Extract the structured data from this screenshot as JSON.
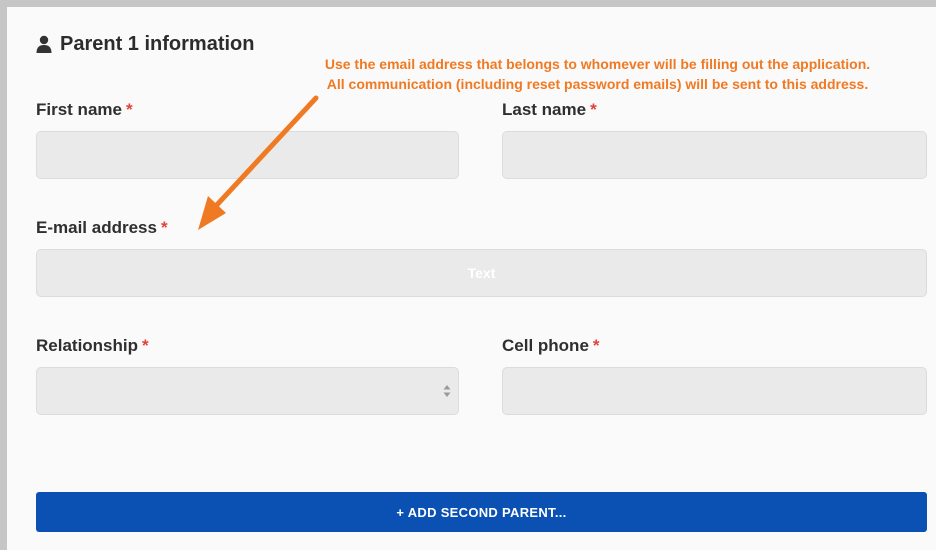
{
  "section": {
    "title": "Parent 1 information",
    "icon": "user-icon"
  },
  "annotation": {
    "line1": "Use the email address that belongs to whomever will be filling out the application.",
    "line2": "All communication (including reset password emails) will be sent to this address.",
    "color": "#f07a23"
  },
  "required_mark": "*",
  "fields": {
    "first_name": {
      "label": "First name",
      "value": ""
    },
    "last_name": {
      "label": "Last name",
      "value": ""
    },
    "email": {
      "label": "E-mail address",
      "value": "",
      "placeholder": "Text"
    },
    "relationship": {
      "label": "Relationship",
      "value": ""
    },
    "cell_phone": {
      "label": "Cell phone",
      "value": ""
    }
  },
  "add_parent_button": {
    "label": "+ ADD SECOND PARENT...",
    "color": "#0b50b3"
  }
}
